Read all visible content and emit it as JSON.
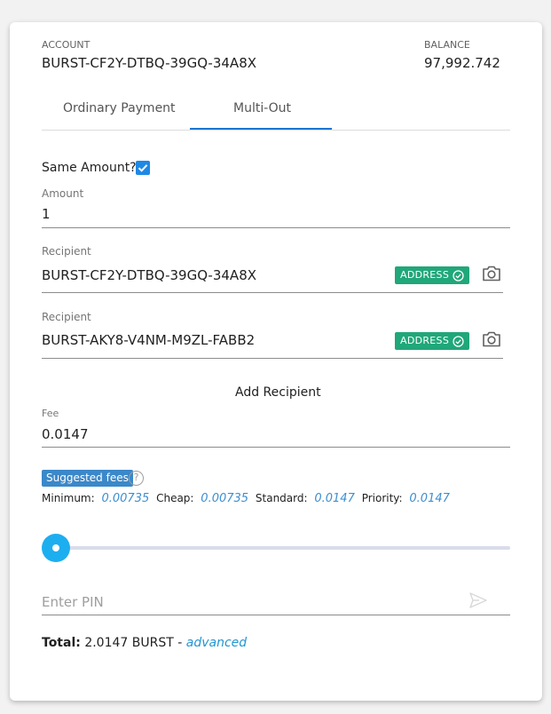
{
  "account": {
    "label": "ACCOUNT",
    "value": "BURST-CF2Y-DTBQ-39GQ-34A8X"
  },
  "balance": {
    "label": "BALANCE",
    "value": "97,992.742"
  },
  "tabs": [
    {
      "label": "Ordinary Payment",
      "active": false
    },
    {
      "label": "Multi-Out",
      "active": true
    }
  ],
  "same_amount": {
    "label": "Same Amount?",
    "checked": true
  },
  "amount": {
    "label": "Amount",
    "value": "1"
  },
  "recipients": [
    {
      "label": "Recipient",
      "value": "BURST-CF2Y-DTBQ-39GQ-34A8X",
      "badge": "ADDRESS"
    },
    {
      "label": "Recipient",
      "value": "BURST-AKY8-V4NM-M9ZL-FABB2",
      "badge": "ADDRESS"
    }
  ],
  "add_recipient": "Add Recipient",
  "fee": {
    "label": "Fee",
    "value": "0.0147"
  },
  "suggested_fees": {
    "label": "Suggested fees",
    "help": "?",
    "minimum": {
      "label": "Minimum:",
      "value": "0.00735"
    },
    "cheap": {
      "label": "Cheap:",
      "value": "0.00735"
    },
    "standard": {
      "label": "Standard:",
      "value": "0.0147"
    },
    "priority": {
      "label": "Priority:",
      "value": "0.0147"
    }
  },
  "slider": {
    "value": 0
  },
  "pin": {
    "placeholder": "Enter PIN"
  },
  "total": {
    "label": "Total:",
    "value": "2.0147 BURST",
    "separator": "-",
    "link": "advanced"
  },
  "colors": {
    "accent": "#1976d2",
    "badge": "#20a77a",
    "slider": "#1daef0",
    "suggested": "#3b88c9"
  },
  "icons": {
    "check": "check-icon",
    "camera": "camera-icon",
    "send": "send-icon",
    "help": "help-icon"
  }
}
